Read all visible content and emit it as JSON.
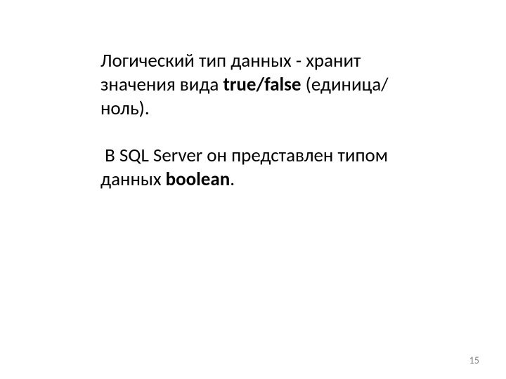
{
  "body": {
    "p1": {
      "pre": "Логический тип данных - хранит значения вида ",
      "bold": "true/false",
      "post": " (единица/ноль)."
    },
    "p2": {
      "pre": " В SQL Server он представлен типом данных ",
      "bold": "boolean",
      "post": "."
    }
  },
  "page_number": "15"
}
